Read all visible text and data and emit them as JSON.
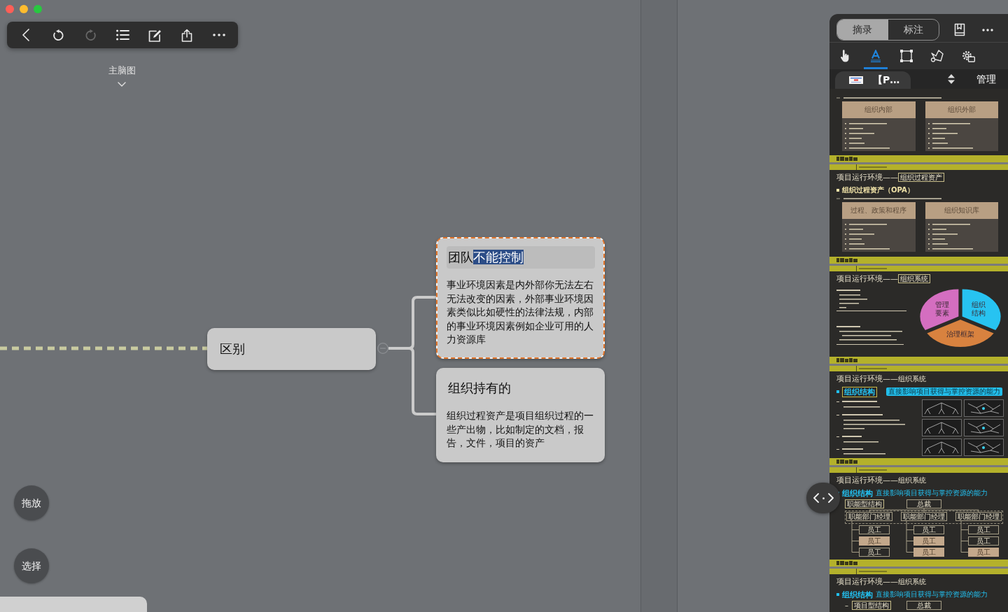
{
  "window": {
    "controls": [
      {
        "kind": "close"
      },
      {
        "kind": "minimize"
      },
      {
        "kind": "zoom"
      }
    ]
  },
  "toolbar": [
    {
      "kind": "back",
      "disabled": false
    },
    {
      "kind": "undo",
      "disabled": false
    },
    {
      "kind": "redo",
      "disabled": true
    },
    {
      "kind": "outline",
      "disabled": false
    },
    {
      "kind": "edit",
      "disabled": false
    },
    {
      "kind": "share",
      "disabled": false
    },
    {
      "kind": "more",
      "disabled": false
    }
  ],
  "map_switcher": {
    "label": "主脑图"
  },
  "mindmap": {
    "parent": {
      "title": "区别",
      "expanded": true
    },
    "children": [
      {
        "title": [
          {
            "text": "团队",
            "selected": false
          },
          {
            "text": "不能控制",
            "selected": true
          }
        ],
        "editing": true,
        "selected": true,
        "body": "事业环境因素是内外部你无法左右无法改变的因素，外部事业环境因素类似比如硬性的法律法规，内部的事业环境因素例如企业可用的人力资源库"
      },
      {
        "title": [
          {
            "text": "组织持有的",
            "selected": false
          }
        ],
        "editing": false,
        "selected": false,
        "body": "组织过程资产是项目组织过程的一些产出物，比如制定的文档，报告，文件，项目的资产"
      }
    ]
  },
  "mode_buttons": [
    {
      "label": "拖放"
    },
    {
      "label": "选择"
    }
  ],
  "panel": {
    "segments": [
      {
        "label": "摘录",
        "selected": true
      },
      {
        "label": "标注",
        "selected": false
      }
    ],
    "tools": [
      {
        "kind": "pointer",
        "selected": false
      },
      {
        "kind": "highlight",
        "selected": true
      },
      {
        "kind": "rectangle",
        "selected": false
      },
      {
        "kind": "lasso",
        "selected": false
      },
      {
        "kind": "settings",
        "selected": false
      }
    ],
    "document_tab": {
      "label": "【P…"
    },
    "manage_label": "管理",
    "slides": [
      {
        "kind": "comparison",
        "boxes": [
          {
            "title": "组织内部"
          },
          {
            "title": "组织外部"
          }
        ]
      },
      {
        "kind": "comparison",
        "heading": "项目运行环境——",
        "tag": "组织过程资产",
        "tag_boxed": true,
        "bullet": "组织过程资产（OPA）",
        "boxes": [
          {
            "title": "过程、政策和程序"
          },
          {
            "title": "组织知识库"
          }
        ]
      },
      {
        "kind": "pie",
        "heading": "项目运行环境——",
        "tag": "组织系统",
        "tag_boxed": true,
        "slices": [
          {
            "label": "组织结构",
            "color": "#27c3f1"
          },
          {
            "label": "治理框架",
            "color": "#d8823f"
          },
          {
            "label": "管理要素",
            "color": "#d46ec0"
          }
        ]
      },
      {
        "kind": "diagrams",
        "heading": "项目运行环境——",
        "tag": "组织系统",
        "tag_boxed": false,
        "bullet": "组织结构",
        "bullet_boxed": true,
        "note": "直接影响项目获得与掌控资源的能力"
      },
      {
        "kind": "org_chart",
        "heading": "项目运行环境——",
        "tag": "组织系统",
        "tag_boxed": false,
        "bullet": "组织结构",
        "bullet_boxed": false,
        "note": "直接影响项目获得与掌控资源的能力",
        "structure": "职能型结构",
        "top": "总裁",
        "managers": [
          "职能部门经理",
          "职能部门经理",
          "职能部门经理"
        ],
        "staff": [
          {
            "label": "员工",
            "highlighted": false
          },
          {
            "label": "员工",
            "highlighted": false
          },
          {
            "label": "员工",
            "highlighted": false
          },
          {
            "label": "员工",
            "highlighted": true
          },
          {
            "label": "员工",
            "highlighted": true
          },
          {
            "label": "员工",
            "highlighted": false
          },
          {
            "label": "员工",
            "highlighted": false
          },
          {
            "label": "员工",
            "highlighted": true
          },
          {
            "label": "员工",
            "highlighted": true
          }
        ]
      },
      {
        "kind": "org_chart",
        "heading": "项目运行环境——",
        "tag": "组织系统",
        "tag_boxed": false,
        "bullet": "组织结构",
        "bullet_boxed": false,
        "note": "直接影响项目获得与掌控资源的能力",
        "marker": "–",
        "structure": "项目型结构",
        "top": "总裁"
      }
    ]
  }
}
